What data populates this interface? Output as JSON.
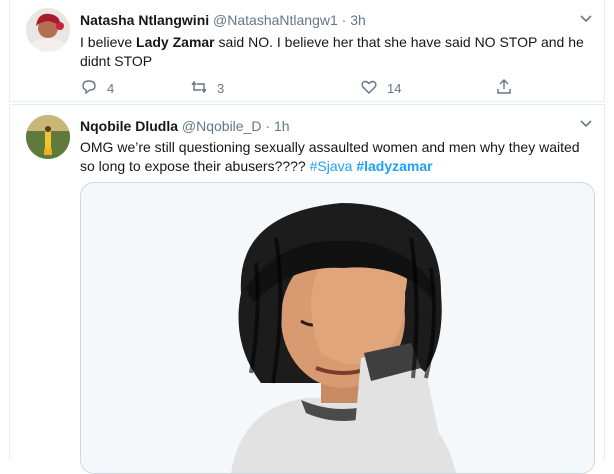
{
  "tweets": [
    {
      "name": "Natasha Ntlangwini",
      "handle": "@NatashaNtlangw1",
      "dot": "·",
      "time": "3h",
      "text_1": "I believe ",
      "text_2": "Lady Zamar",
      "text_3": " said NO. I believe her that she have  said  NO STOP and he didnt STOP",
      "reply_count": "4",
      "retweet_count": "3",
      "like_count": "14"
    },
    {
      "name": "Nqobile Dludla",
      "handle": "@Nqobile_D",
      "dot": "·",
      "time": "1h",
      "text_1": "OMG we’re still questioning sexually assaulted women and men why they waited so long to expose their abusers???? ",
      "hashtag_1": "#Sjava",
      "hashtag_2": "#ladyzamar"
    }
  ],
  "icons": {
    "caret": "chevron-down-icon",
    "reply": "reply-icon",
    "retweet": "retweet-icon",
    "like": "heart-icon",
    "share": "share-icon",
    "media": "facepalm-emoji-image"
  },
  "colors": {
    "link": "#1da1f2",
    "muted": "#657786",
    "border": "#e6ecf0"
  }
}
